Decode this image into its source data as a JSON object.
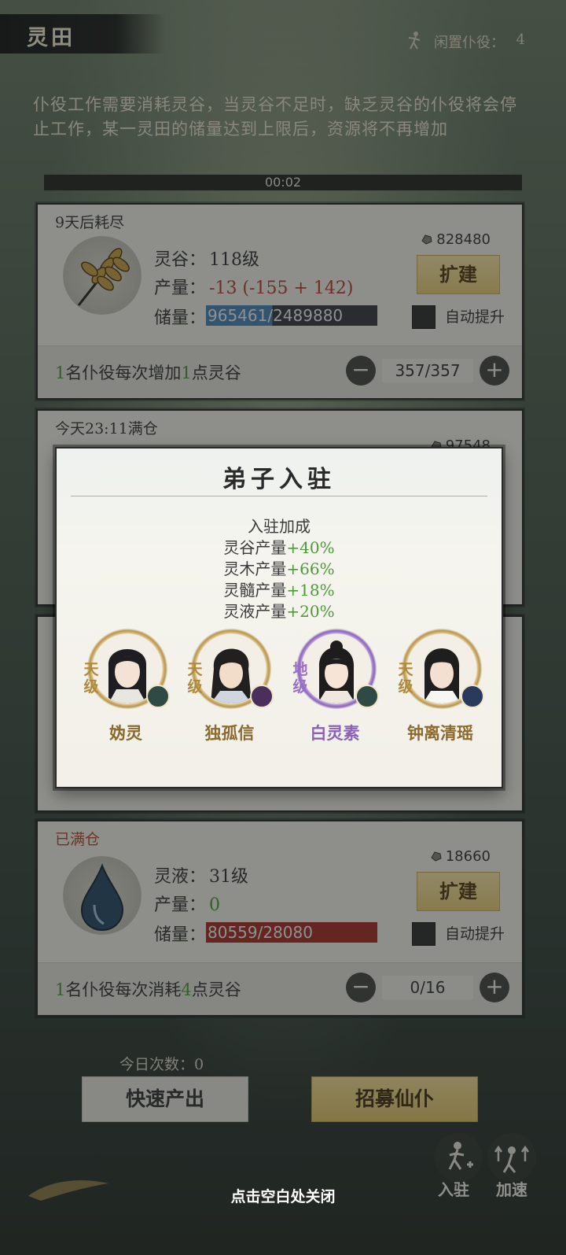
{
  "header": {
    "title": "灵田",
    "idle_label": "闲置仆役：",
    "idle_value": "4"
  },
  "notice": "仆役工作需要消耗灵谷，当灵谷不足时，缺乏灵谷的仆役将会停止工作，某一灵田的储量达到上限后，资源将不再增加",
  "timer": "00:02",
  "card1": {
    "status": "9天后耗尽",
    "resource_label": "灵谷：",
    "resource_level": "118级",
    "output_label": "产量：",
    "output_value": "-13 (-155 + 142)",
    "storage_label": "储量：",
    "storage_value": "965461/2489880",
    "storage_fraction": 0.388,
    "cost": "828480",
    "expand_label": "扩建",
    "auto_label": "自动提升",
    "foot_prefix": "1",
    "foot_mid": "名仆役每次增加",
    "foot_num": "1",
    "foot_suffix": "点灵谷",
    "stepper_value": "357/357"
  },
  "card2": {
    "status": "今天23:11满仓",
    "cost": "97548"
  },
  "card4": {
    "status": "已满仓",
    "resource_label": "灵液：",
    "resource_level": "31级",
    "output_label": "产量：",
    "output_value": "0",
    "storage_label": "储量：",
    "storage_value": "80559/28080",
    "cost": "18660",
    "expand_label": "扩建",
    "auto_label": "自动提升",
    "foot_prefix": "1",
    "foot_mid": "名仆役每次消耗",
    "foot_num": "4",
    "foot_suffix": "点灵谷",
    "stepper_value": "0/16"
  },
  "bottom": {
    "count_label": "今日次数：0",
    "fast_label": "快速产出",
    "recruit_label": "招募仙仆",
    "settle_label": "入驻",
    "speed_label": "加速",
    "close_hint": "点击空白处关闭"
  },
  "modal": {
    "title": "弟子入驻",
    "bonus_title": "入驻加成",
    "bonuses": [
      {
        "label": "灵谷产量",
        "value": "+40%"
      },
      {
        "label": "灵木产量",
        "value": "+66%"
      },
      {
        "label": "灵髓产量",
        "value": "+18%"
      },
      {
        "label": "灵液产量",
        "value": "+20%"
      }
    ],
    "disciples": [
      {
        "name": "妫灵",
        "grade": "天级",
        "element": "wind-icon"
      },
      {
        "name": "独孤信",
        "grade": "天级",
        "element": "flame-icon"
      },
      {
        "name": "白灵素",
        "grade": "地级",
        "element": "wind-icon"
      },
      {
        "name": "钟离清瑶",
        "grade": "天级",
        "element": "water-icon"
      }
    ]
  },
  "colors": {
    "positive": "#4e9a3a",
    "negative": "#b8403a",
    "gold": "#e9cc7c",
    "di_grade": "#9a6fc8",
    "tian_grade": "#b08a3a"
  }
}
